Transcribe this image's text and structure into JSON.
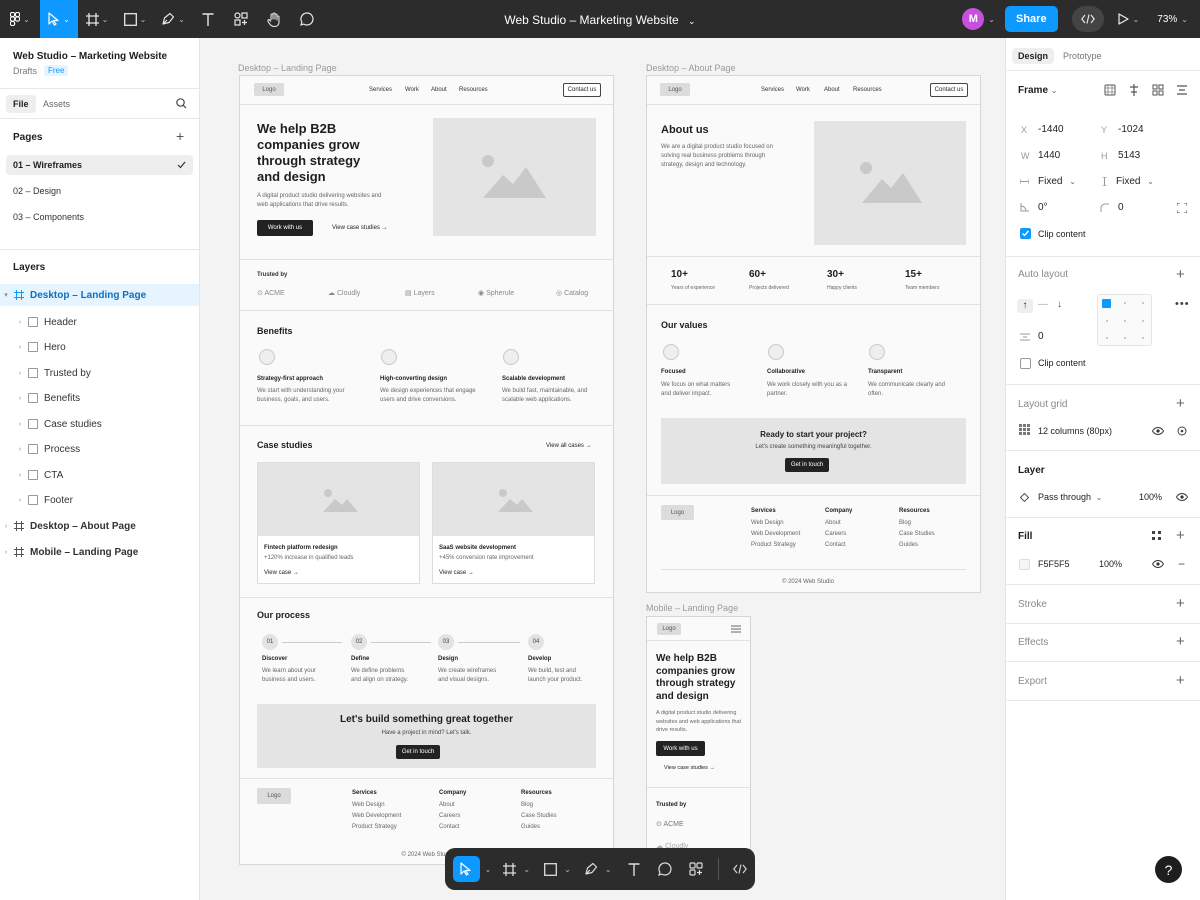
{
  "app": {
    "file_title": "Web Studio – Marketing Website",
    "avatar_initial": "M",
    "share_label": "Share",
    "zoom": "73%"
  },
  "left": {
    "file_name": "Web Studio – Marketing Website",
    "location": "Drafts",
    "plan": "Free",
    "tab_file": "File",
    "tab_assets": "Assets",
    "pages_title": "Pages",
    "pages": [
      "01 – Wireframes",
      "02 – Design",
      "03 – Components"
    ],
    "layers_title": "Layers",
    "layers": [
      "Desktop – Landing Page",
      "Header",
      "Hero",
      "Trusted by",
      "Benefits",
      "Case studies",
      "Process",
      "CTA",
      "Footer",
      "Desktop – About Page",
      "Mobile – Landing Page"
    ]
  },
  "right": {
    "tab_design": "Design",
    "tab_prototype": "Prototype",
    "frame_label": "Frame",
    "x_label": "X",
    "x": "-1440",
    "y_label": "Y",
    "y": "-1024",
    "w_label": "W",
    "w": "1440",
    "h_label": "H",
    "h": "5143",
    "sizing_w": "Fixed",
    "sizing_h": "Fixed",
    "rotation": "0°",
    "radius": "0",
    "clip_content": "Clip content",
    "auto_layout": "Auto layout",
    "gap": "0",
    "clip_content2": "Clip content",
    "layout_grid": "Layout grid",
    "grid_value": "12 columns (80px)",
    "layer": "Layer",
    "blend": "Pass through",
    "opacity": "100%",
    "fill": "Fill",
    "fill_hex": "F5F5F5",
    "fill_opacity": "100%",
    "stroke": "Stroke",
    "effects": "Effects",
    "export": "Export"
  },
  "landing": {
    "label": "Desktop – Landing Page",
    "logo": "Logo",
    "nav": [
      "Services",
      "Work",
      "About",
      "Resources"
    ],
    "contact": "Contact us",
    "hero_title": "We help B2B companies grow through strategy and design",
    "hero_sub": "A digital product studio delivering websites and web applications that drive results.",
    "cta_primary": "Work with us",
    "cta_secondary": "View case studies →",
    "trusted": "Trusted by",
    "logos": [
      "ACME",
      "Cloudly",
      "Layers",
      "Spherule",
      "Catalog"
    ],
    "benefits_title": "Benefits",
    "benefits": [
      {
        "t": "Strategy-first approach",
        "d": "We start with understanding your business, goals, and users."
      },
      {
        "t": "High-converting design",
        "d": "We design experiences that engage users and drive conversions."
      },
      {
        "t": "Scalable development",
        "d": "We build fast, maintainable, and scalable web applications."
      }
    ],
    "cases_title": "Case studies",
    "view_all": "View all cases →",
    "cases": [
      {
        "t": "Fintech platform redesign",
        "d": "+120% increase in qualified leads",
        "l": "View case →"
      },
      {
        "t": "SaaS website development",
        "d": "+45% conversion rate improvement",
        "l": "View case →"
      }
    ],
    "process_title": "Our process",
    "process": [
      {
        "n": "01",
        "t": "Discover",
        "d": "We learn about your business and users."
      },
      {
        "n": "02",
        "t": "Define",
        "d": "We define problems and align on strategy."
      },
      {
        "n": "03",
        "t": "Design",
        "d": "We create wireframes and visual designs."
      },
      {
        "n": "04",
        "t": "Develop",
        "d": "We build, test and launch your product."
      }
    ],
    "cta_title": "Let's build something great together",
    "cta_sub": "Have a project in mind? Let's talk.",
    "cta_btn": "Get in touch",
    "footer_cols": [
      {
        "h": "Services",
        "items": [
          "Web Design",
          "Web Development",
          "Product Strategy"
        ]
      },
      {
        "h": "Company",
        "items": [
          "About",
          "Careers",
          "Contact"
        ]
      },
      {
        "h": "Resources",
        "items": [
          "Blog",
          "Case Studies",
          "Guides"
        ]
      }
    ],
    "copyright": "© 2024 Web Studio"
  },
  "about": {
    "label": "Desktop – About Page",
    "title": "About us",
    "sub": "We are a digital product studio focused on solving real business problems through strategy, design and technology.",
    "stats": [
      {
        "v": "10+",
        "l": "Years of experience"
      },
      {
        "v": "60+",
        "l": "Projects delivered"
      },
      {
        "v": "30+",
        "l": "Happy clients"
      },
      {
        "v": "15+",
        "l": "Team members"
      }
    ],
    "values_title": "Our values",
    "values": [
      {
        "t": "Focused",
        "d": "We focus on what matters and deliver impact."
      },
      {
        "t": "Collaborative",
        "d": "We work closely with you as a partner."
      },
      {
        "t": "Transparent",
        "d": "We communicate clearly and often."
      }
    ],
    "cta_title": "Ready to start your project?",
    "cta_sub": "Let's create something meaningful together.",
    "cta_btn": "Get in touch"
  },
  "mobile": {
    "label": "Mobile – Landing Page",
    "hero_title": "We help B2B companies grow through strategy and design",
    "hero_sub": "A digital product studio delivering websites and web applications that drive results.",
    "trusted": "Trusted by",
    "logo1": "ACME",
    "logo2": "Cloudly"
  },
  "colors": {
    "accent": "#0d99ff",
    "toolbar": "#2c2c2c",
    "canvas": "#f3f3f3"
  }
}
